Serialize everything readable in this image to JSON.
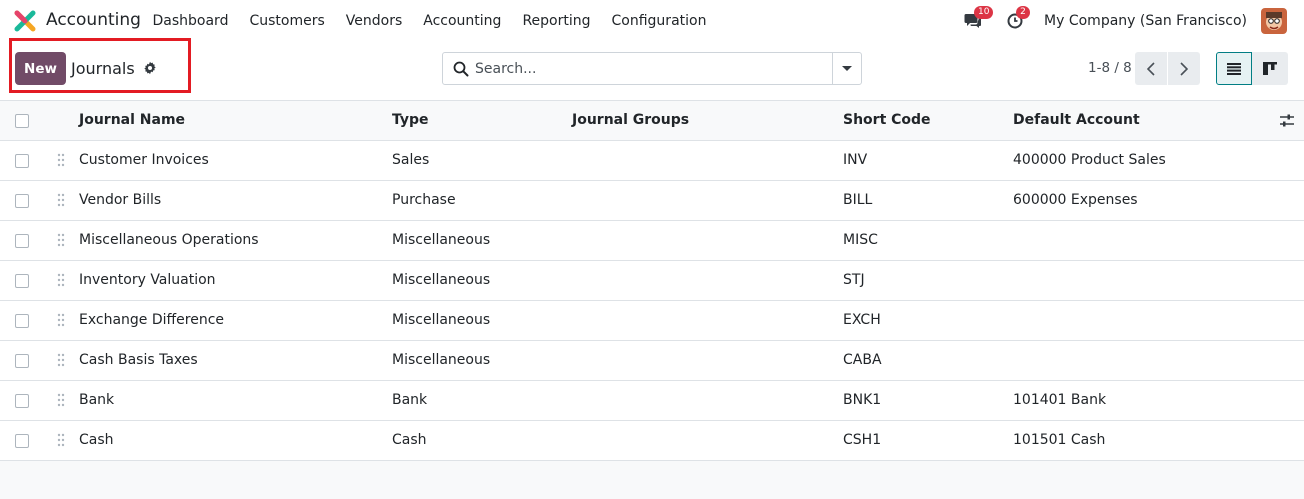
{
  "navbar": {
    "app_name": "Accounting",
    "menu": [
      "Dashboard",
      "Customers",
      "Vendors",
      "Accounting",
      "Reporting",
      "Configuration"
    ],
    "messages_count": "10",
    "activities_count": "2",
    "company": "My Company (San Francisco)"
  },
  "control_panel": {
    "new_label": "New",
    "title": "Journals",
    "search_placeholder": "Search...",
    "pager": "1-8 / 8"
  },
  "colors": {
    "brand": "#714b67",
    "accent": "#017e84",
    "highlight": "#e31b23",
    "badge": "#dc3545"
  },
  "table": {
    "headers": {
      "name": "Journal Name",
      "type": "Type",
      "groups": "Journal Groups",
      "code": "Short Code",
      "account": "Default Account"
    },
    "rows": [
      {
        "name": "Customer Invoices",
        "type": "Sales",
        "groups": "",
        "code": "INV",
        "account": "400000 Product Sales"
      },
      {
        "name": "Vendor Bills",
        "type": "Purchase",
        "groups": "",
        "code": "BILL",
        "account": "600000 Expenses"
      },
      {
        "name": "Miscellaneous Operations",
        "type": "Miscellaneous",
        "groups": "",
        "code": "MISC",
        "account": ""
      },
      {
        "name": "Inventory Valuation",
        "type": "Miscellaneous",
        "groups": "",
        "code": "STJ",
        "account": ""
      },
      {
        "name": "Exchange Difference",
        "type": "Miscellaneous",
        "groups": "",
        "code": "EXCH",
        "account": ""
      },
      {
        "name": "Cash Basis Taxes",
        "type": "Miscellaneous",
        "groups": "",
        "code": "CABA",
        "account": ""
      },
      {
        "name": "Bank",
        "type": "Bank",
        "groups": "",
        "code": "BNK1",
        "account": "101401 Bank"
      },
      {
        "name": "Cash",
        "type": "Cash",
        "groups": "",
        "code": "CSH1",
        "account": "101501 Cash"
      }
    ]
  }
}
